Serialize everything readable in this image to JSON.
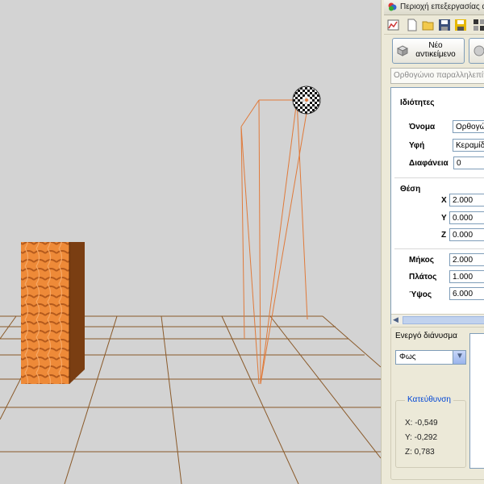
{
  "window": {
    "title": "Περιοχή επεξεργασίας αν"
  },
  "toolbar": {
    "icons": [
      "chart-icon",
      "new-file-icon",
      "open-folder-icon",
      "save-icon",
      "save-all-icon",
      "grid-icon"
    ]
  },
  "buttons": {
    "new_object": "Νέο αντικείμενο"
  },
  "object_selector": {
    "placeholder": "Ορθογώνιο παραλληλεπίπεδο"
  },
  "properties": {
    "title": "Ιδιότητες",
    "name_label": "Όνομα",
    "name_value": "Ορθογώ",
    "texture_label": "Υφή",
    "texture_value": "Κεραμίδι",
    "transparency_label": "Διαφάνεια",
    "transparency_value": "0",
    "position_label": "Θέση",
    "x_label": "X",
    "x_value": "2.000",
    "y_label": "Y",
    "y_value": "0.000",
    "z_label": "Z",
    "z_value": "0.000",
    "length_label": "Μήκος",
    "length_value": "2.000",
    "width_label": "Πλάτος",
    "width_value": "1.000",
    "height_label": "Ύψος",
    "height_value": "6.000"
  },
  "vector": {
    "label": "Ενεργό διάνυσμα",
    "selected": "Φως",
    "direction_title": "Κατεύθυνση",
    "x": "X: -0,549",
    "y": "Y: -0,292",
    "z": "Z: 0,783"
  },
  "colors": {
    "background": "#d3d3d3",
    "grid": "#8a5a2a",
    "selection": "#e07a3a",
    "box_front": "#f08a3a",
    "box_side": "#7a3a10"
  }
}
